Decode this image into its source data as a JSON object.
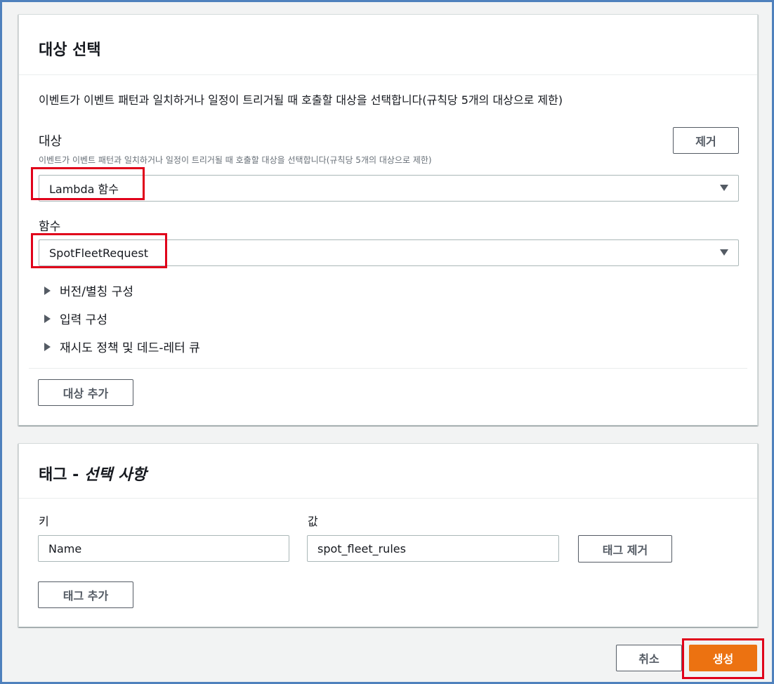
{
  "target_section": {
    "title": "대상 선택",
    "description": "이벤트가 이벤트 패턴과 일치하거나 일정이 트리거될 때 호출할 대상을 선택합니다(규칙당 5개의 대상으로 제한)",
    "target_label": "대상",
    "target_hint": "이벤트가 이벤트 패턴과 일치하거나 일정이 트리거될 때 호출할 대상을 선택합니다(규칙당 5개의 대상으로 제한)",
    "remove_label": "제거",
    "target_type_value": "Lambda 함수",
    "function_label": "함수",
    "function_value": "SpotFleetRequest",
    "expanders": [
      "버전/별칭 구성",
      "입력 구성",
      "재시도 정책 및 데드-레터 큐"
    ],
    "add_target_label": "대상 추가"
  },
  "tags_section": {
    "title_main": "태그 - ",
    "title_italic": "선택 사항",
    "key_label": "키",
    "value_label": "값",
    "key_value": "Name",
    "value_value": "spot_fleet_rules",
    "remove_tag_label": "태그 제거",
    "add_tag_label": "태그 추가"
  },
  "footer": {
    "cancel_label": "취소",
    "create_label": "생성"
  },
  "colors": {
    "primary": "#ec7211",
    "highlight": "#e0001a",
    "frame_border": "#4f81bd"
  }
}
